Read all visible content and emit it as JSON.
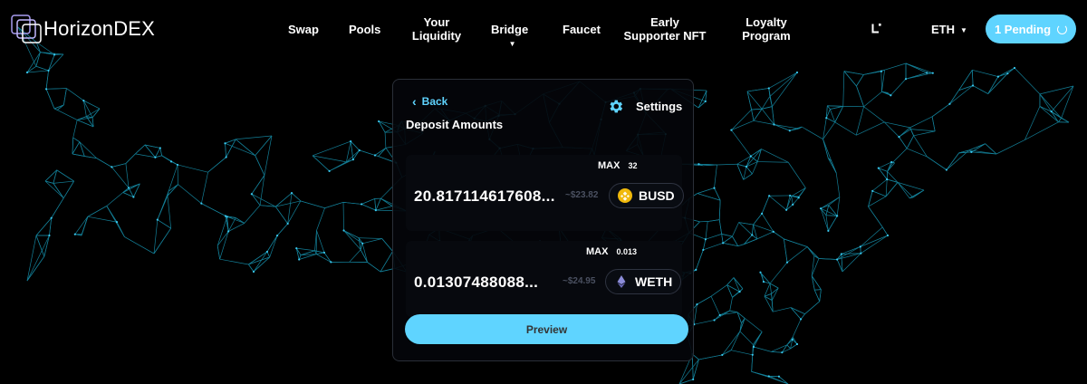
{
  "brand": {
    "name": "HorizonDEX"
  },
  "nav": {
    "swap": "Swap",
    "pools": "Pools",
    "liquidity_line1": "Your",
    "liquidity_line2": "Liquidity",
    "bridge": "Bridge",
    "faucet": "Faucet",
    "nft_line1": "Early",
    "nft_line2": "Supporter NFT",
    "loyalty_line1": "Loyalty",
    "loyalty_line2": "Program"
  },
  "network": {
    "selected": "ETH"
  },
  "pending": {
    "label": "1 Pending"
  },
  "card": {
    "back": "Back",
    "title": "Deposit Amounts",
    "settings": "Settings",
    "tokens": [
      {
        "max_label": "MAX",
        "max_value": "32",
        "amount": "20.817114617608...",
        "usd": "~$23.82",
        "symbol": "BUSD",
        "icon": "busd-coin-icon"
      },
      {
        "max_label": "MAX",
        "max_value": "0.013",
        "amount": "0.01307488088...",
        "usd": "~$24.95",
        "symbol": "WETH",
        "icon": "eth-diamond-icon"
      }
    ],
    "preview": "Preview"
  },
  "colors": {
    "accent": "#5fd4ff",
    "background": "#000000",
    "mesh": "#1aa8c8",
    "busd": "#f0b90b",
    "eth": "#8c8cd8"
  }
}
